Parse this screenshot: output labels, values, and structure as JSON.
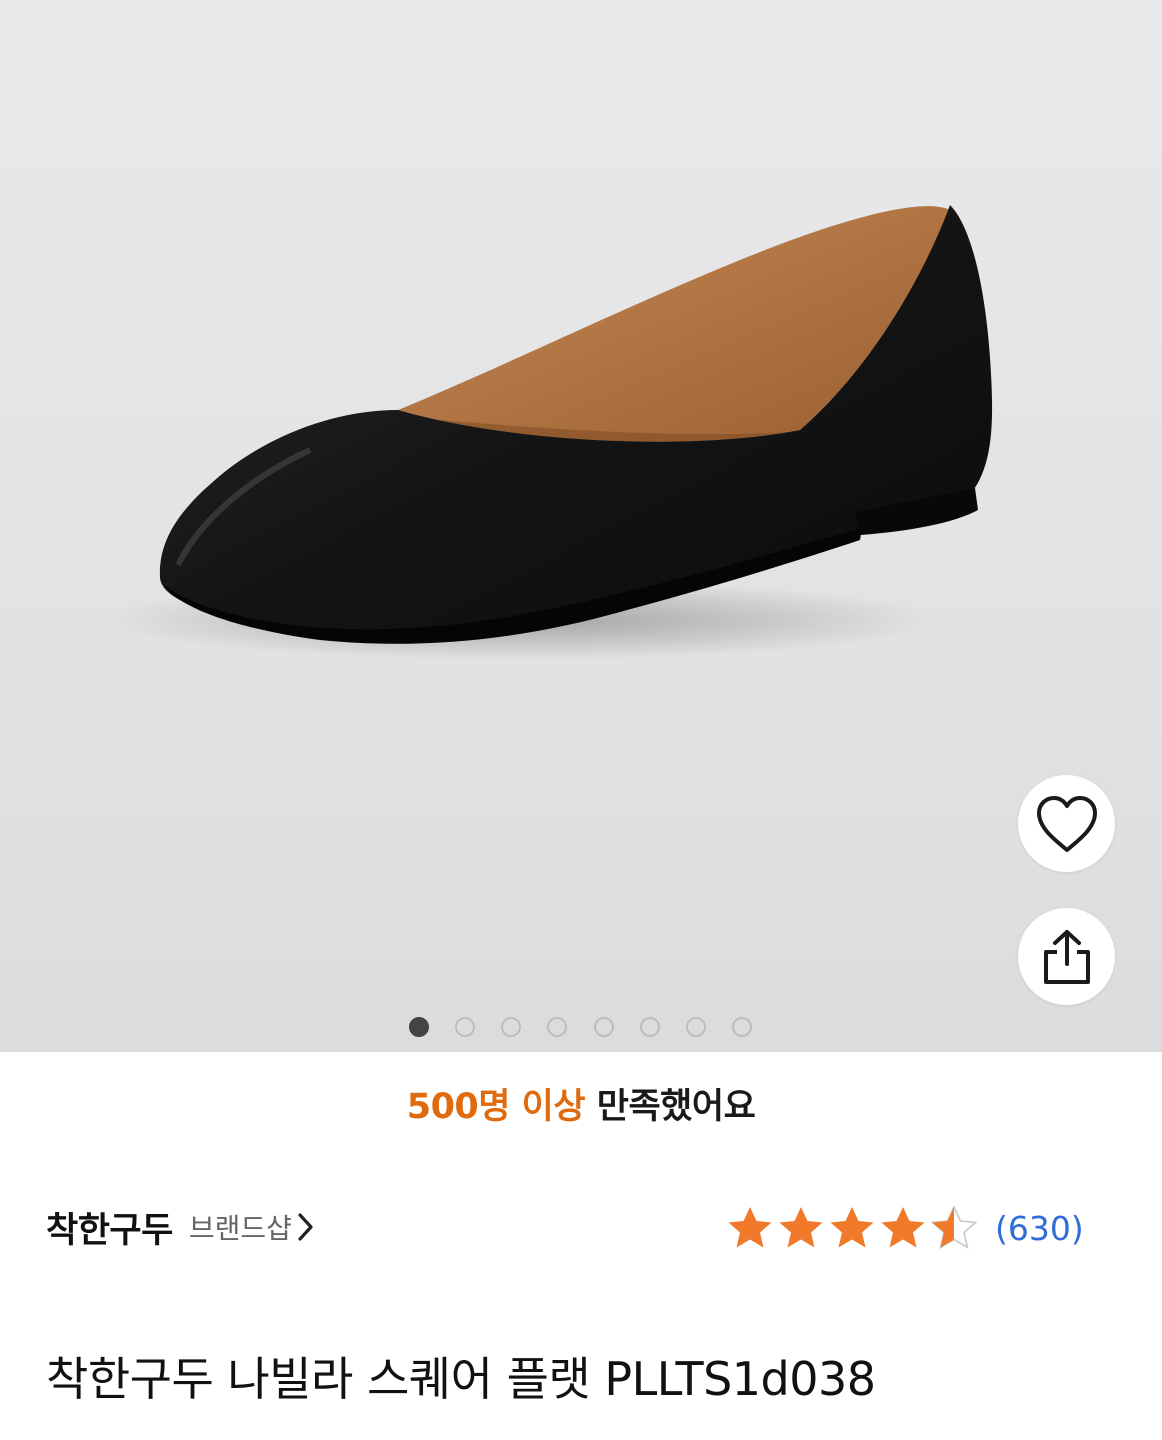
{
  "product_image": {
    "alt": "black square-toe flat shoe",
    "carousel": {
      "total": 8,
      "active_index": 0
    }
  },
  "actions": {
    "like_icon": "heart-outline-icon",
    "share_icon": "share-upload-icon"
  },
  "satisfaction": {
    "highlight": "500명 이상",
    "rest": " 만족했어요",
    "highlight_color": "#e06a0e"
  },
  "brand": {
    "name": "착한구두",
    "shop_link": "브랜드샵"
  },
  "rating": {
    "stars": 4.5,
    "max": 5,
    "count": "(630)",
    "star_color": "#f0792a",
    "count_color": "#2f6ed8"
  },
  "product": {
    "title": "착한구두 나빌라 스퀘어 플랫 PLLTS1d038"
  }
}
